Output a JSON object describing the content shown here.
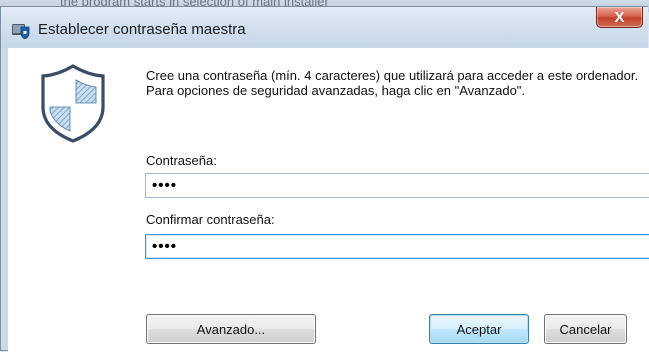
{
  "window": {
    "title": "Establecer contraseña maestra",
    "close_label": "X",
    "background_title_fragment": "the program starts in selection of main installer"
  },
  "content": {
    "description": "Cree una contraseña (mín. 4 caracteres) que utilizará para acceder a este ordenador. Para opciones de seguridad avanzadas, haga clic en \"Avanzado\".",
    "password_label": "Contraseña:",
    "password_value": "••••",
    "confirm_label": "Confirmar contraseña:",
    "confirm_value": "••••"
  },
  "buttons": {
    "advanced": "Avanzado...",
    "accept": "Aceptar",
    "cancel": "Cancelar"
  },
  "icons": {
    "title_icon": "lock-shield-icon",
    "main_icon": "shield-icon"
  },
  "colors": {
    "accent": "#3c7fb1",
    "close_button": "#c1402a",
    "titlebar": "#d2e0ee"
  }
}
